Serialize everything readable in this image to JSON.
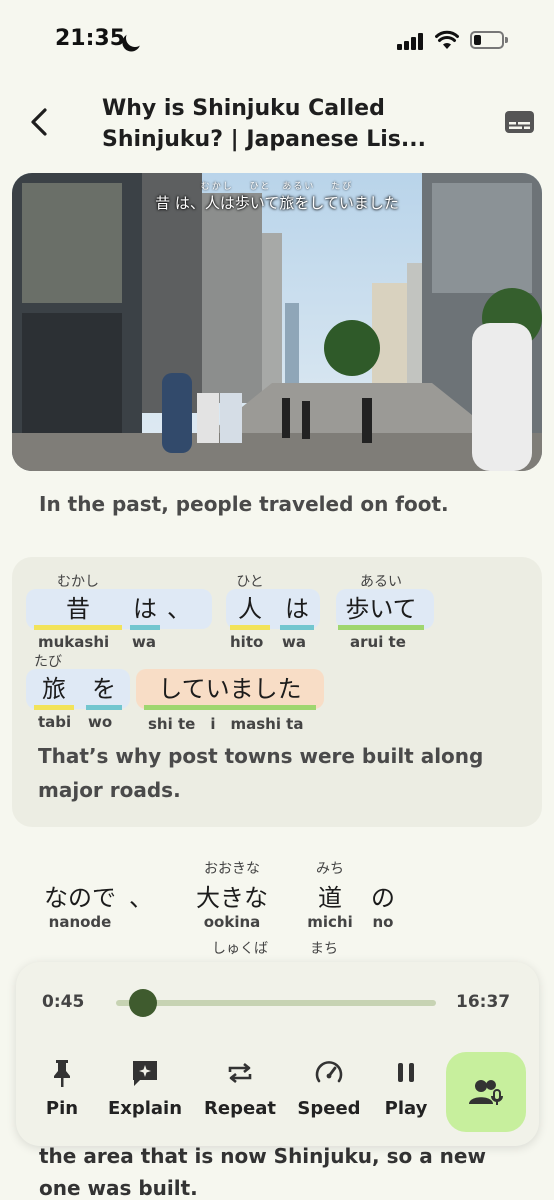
{
  "status_bar": {
    "time": "21:35"
  },
  "nav": {
    "title": "Why is Shinjuku Called\nShinjuku? | Japanese Lis..."
  },
  "video": {
    "caption_furigana": "むかし　 ひと　あるい　 たび",
    "caption": "昔 は、人は歩いて旅をしていました"
  },
  "previous_translation": "In the past, people traveled on foot.",
  "current_sentence": {
    "tokens": [
      {
        "jp": "昔",
        "furigana": "むかし",
        "romaji": "mukashi",
        "color": "#f2e35a"
      },
      {
        "jp": "は",
        "furigana": "",
        "romaji": "wa",
        "color": "#72c6cf"
      },
      {
        "jp": "、",
        "furigana": "",
        "romaji": "",
        "color": ""
      },
      {
        "jp": "人",
        "furigana": "ひと",
        "romaji": "hito",
        "color": "#f2e35a"
      },
      {
        "jp": "は",
        "furigana": "",
        "romaji": "wa",
        "color": "#72c6cf"
      },
      {
        "jp": "歩いて",
        "furigana": "あるい",
        "romaji": "arui te",
        "color": "#9fd66f"
      },
      {
        "jp": "旅",
        "furigana": "たび",
        "romaji": "tabi",
        "color": "#f2e35a"
      },
      {
        "jp": "を",
        "furigana": "",
        "romaji": "wo",
        "color": "#72c6cf"
      },
      {
        "jp": "していました",
        "furigana": "",
        "romaji": "shi te　i　mashi ta",
        "color": "#9fd66f"
      }
    ],
    "translation": "That’s why post towns were built along major roads."
  },
  "next_sentence": {
    "tokens": [
      {
        "jp": "なので",
        "furigana": "",
        "romaji": "nanode"
      },
      {
        "jp": "、",
        "furigana": "",
        "romaji": ""
      },
      {
        "jp": "大きな",
        "furigana": "おおきな",
        "romaji": "ookina"
      },
      {
        "jp": "道",
        "furigana": "みち",
        "romaji": "michi"
      },
      {
        "jp": "の",
        "furigana": "",
        "romaji": "no"
      }
    ],
    "following_furigana": [
      "しゅくば",
      "まち"
    ]
  },
  "bottom_text": "the area that is now Shinjuku, so a new one was built.",
  "player": {
    "current_time": "0:45",
    "total_time": "16:37",
    "progress": 0.045,
    "controls": [
      {
        "label": "Pin",
        "icon": "pin-icon"
      },
      {
        "label": "Explain",
        "icon": "explain-icon"
      },
      {
        "label": "Repeat",
        "icon": "repeat-icon"
      },
      {
        "label": "Speed",
        "icon": "speed-icon"
      },
      {
        "label": "Play",
        "icon": "pause-icon"
      }
    ],
    "accent_color": "#c7ef9d"
  }
}
